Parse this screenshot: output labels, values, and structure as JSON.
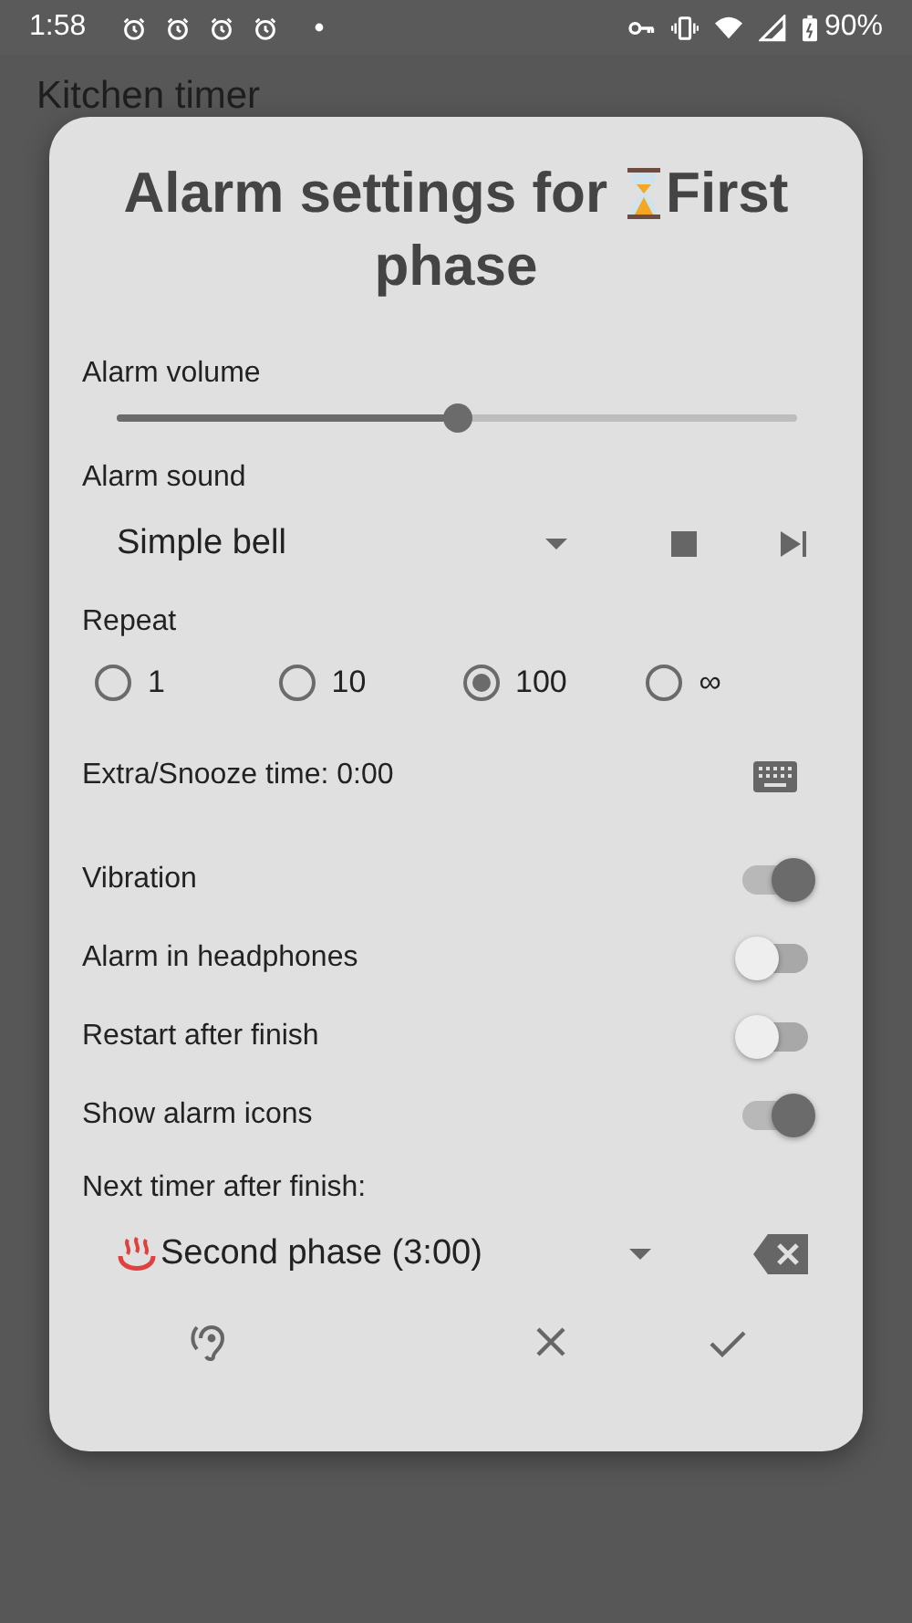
{
  "status_bar": {
    "time": "1:58",
    "battery": "90%"
  },
  "app_bar": {
    "title": "Kitchen timer"
  },
  "dialog": {
    "title_before": "Alarm settings for",
    "title_after": "First",
    "title_line2": "phase",
    "volume": {
      "label": "Alarm volume",
      "level": 0.5
    },
    "sound": {
      "label": "Alarm sound",
      "value": "Simple bell"
    },
    "repeat": {
      "label": "Repeat",
      "options": [
        {
          "label": "1",
          "selected": false
        },
        {
          "label": "10",
          "selected": false
        },
        {
          "label": "100",
          "selected": true
        },
        {
          "label": "∞",
          "selected": false
        }
      ]
    },
    "snooze": {
      "label": "Extra/Snooze time: 0:00"
    },
    "switches": [
      {
        "label": "Vibration",
        "on": true
      },
      {
        "label": "Alarm in headphones",
        "on": false
      },
      {
        "label": "Restart after finish",
        "on": false
      },
      {
        "label": "Show alarm icons",
        "on": true
      }
    ],
    "next_timer": {
      "label": "Next timer after finish:",
      "value": "Second phase (3:00)"
    }
  }
}
